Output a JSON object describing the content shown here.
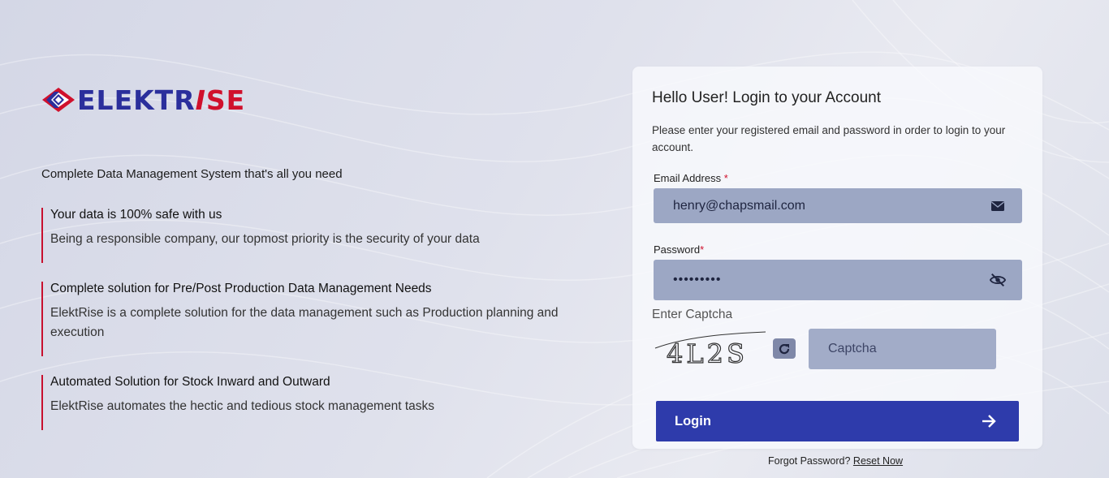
{
  "brand": {
    "name_part1": "ELEKTR",
    "name_part2": "I",
    "name_part3": "SE",
    "colors": {
      "primary": "#2b2f9c",
      "accent": "#d0102c",
      "button": "#2e3bab"
    }
  },
  "intro": {
    "tagline": "Complete Data Management System that's all you need",
    "features": [
      {
        "title": "Your data is 100% safe with us",
        "text": "Being a responsible company, our topmost priority is the security of your data"
      },
      {
        "title": "Complete solution for Pre/Post Production Data Management Needs",
        "text": "ElektRise is a complete solution for the data management such as Production planning and execution"
      },
      {
        "title": "Automated Solution for Stock Inward and Outward",
        "text": "ElektRise automates the hectic and tedious stock management tasks"
      }
    ]
  },
  "login": {
    "title": "Hello User! Login to your Account",
    "subtitle": "Please enter your registered email and password in order to login to your account.",
    "email_label": "Email Address",
    "email_value": "henry@chapsmail.com",
    "email_icon": "envelope-icon",
    "password_label": "Password",
    "required_mark": "*",
    "password_value": "secretpw1",
    "password_icon": "eye-slash-icon",
    "captcha_label": "Enter Captcha",
    "captcha_text": "4L2S",
    "captcha_placeholder": "Captcha",
    "refresh_icon": "refresh-icon",
    "login_label": "Login",
    "login_icon": "arrow-right-icon"
  },
  "footer": {
    "forgot_text": "Forgot Password?",
    "reset_link": "Reset Now"
  }
}
